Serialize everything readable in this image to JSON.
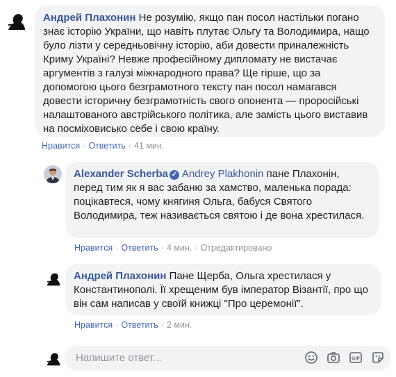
{
  "comments": [
    {
      "author": "Андрей Плахонин",
      "text": "Не розумію, якщо пан посол настільки погано знає історію України, що навіть плутає Ольгу та Володимира, нащо було лізти у середньовічну історію, аби довести приналежність Криму Україні? Невже професійному дипломату не вистачає аргументів з галузі міжнародного права? Ще гірше, що за допомогою цього безграмотного тексту пан посол намагався довести історичну безграмотність свого опонента — проросійські налаштованого австрійського політика, але замість цього виставив на посміховисько себе і свою країну.",
      "like": "Нравится",
      "reply": "Ответить",
      "time": "41 мин."
    },
    {
      "author": "Alexander Scherba",
      "mention": "Andrey Plakhonin",
      "text": "пане Плахонін, перед тим як я вас забаню за хамство, маленька порада: поцікавтеся, чому княгиня Ольга, бабуся Святого Володимира, теж називається святою і де вона хрестилася.",
      "like": "Нравится",
      "reply": "Ответить",
      "time": "4 мин.",
      "edited": "Отредактировано"
    },
    {
      "author": "Андрей Плахонин",
      "text": "Пане Щерба, Ольга хрестилася у Константинополі. Її хрещеним був імператор Візантії, про що він сам написав у своїй книжці \"Про церемонії\".",
      "like": "Нравится",
      "reply": "Ответить",
      "time": "2 мин."
    }
  ],
  "composer": {
    "placeholder": "Напишите ответ...",
    "icons": [
      "emoji-icon",
      "camera-icon",
      "gif-icon",
      "sticker-icon"
    ]
  },
  "colors": {
    "link": "#385898",
    "bubble": "#f2f3f5",
    "meta": "#90949c"
  }
}
